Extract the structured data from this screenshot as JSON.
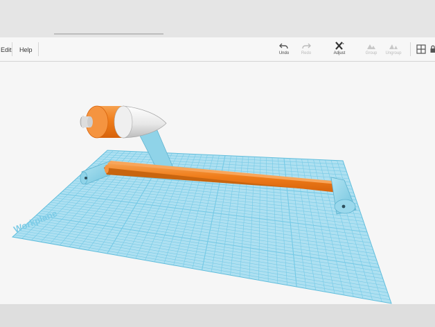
{
  "menu": {
    "items": [
      {
        "id": "edit",
        "label": "Edit"
      },
      {
        "id": "help",
        "label": "Help"
      }
    ]
  },
  "toolbar": {
    "tools": [
      {
        "id": "undo",
        "label": "Undo",
        "icon": "undo-icon",
        "enabled": true
      },
      {
        "id": "redo",
        "label": "Redo",
        "icon": "redo-icon",
        "enabled": false
      },
      {
        "id": "adjust",
        "label": "Adjust",
        "icon": "adjust-icon",
        "enabled": true
      },
      {
        "id": "group",
        "label": "Group",
        "icon": "group-icon",
        "enabled": false
      },
      {
        "id": "ungroup",
        "label": "Ungroup",
        "icon": "ungroup-icon",
        "enabled": false
      }
    ],
    "view_icons": [
      "grid-view-icon",
      "lock-icon"
    ]
  },
  "scene": {
    "workplane_label": "Workplane",
    "colors": {
      "workplane": "#aee0f1",
      "grid_line": "#6cc6e4",
      "shape_orange": "#f07d1a",
      "shape_cyan": "#8fd3e8",
      "shape_white": "#e6e6e6"
    }
  }
}
